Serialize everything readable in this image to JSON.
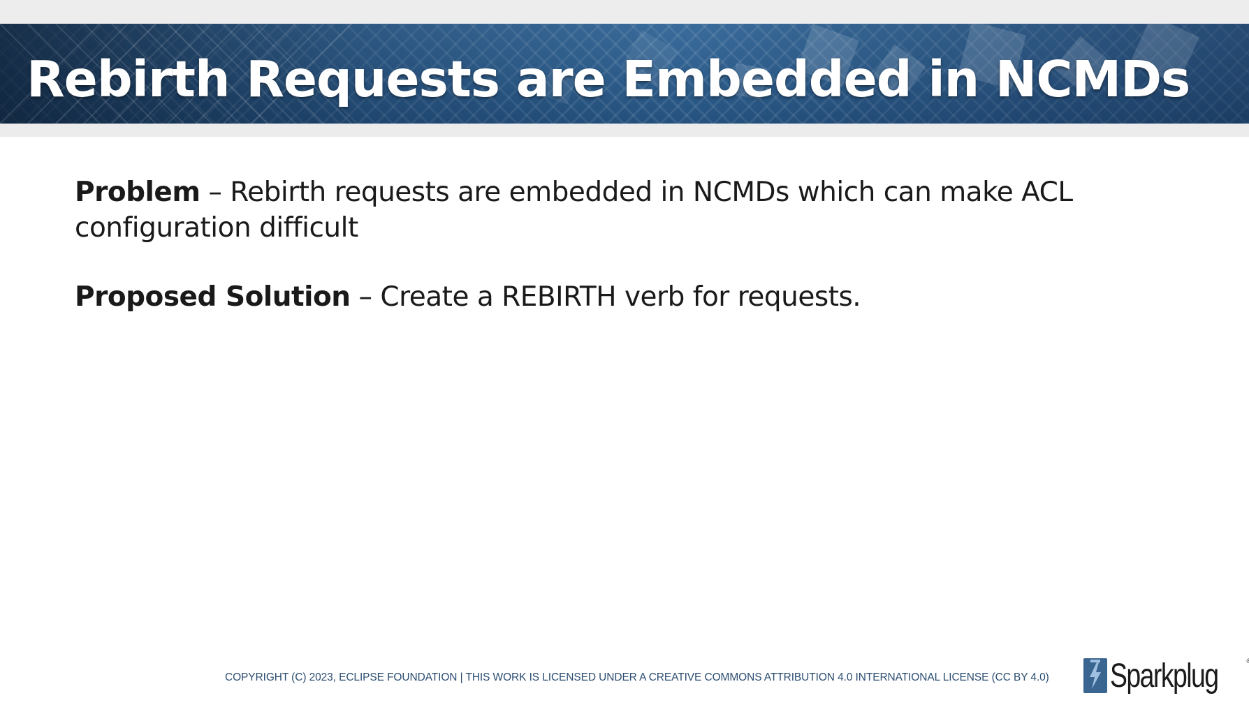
{
  "slide": {
    "title": "Rebirth Requests are Embedded in NCMDs",
    "paragraphs": [
      {
        "label": "Problem",
        "text": " – Rebirth requests are embedded in NCMDs which can make ACL configuration difficult"
      },
      {
        "label": "Proposed Solution",
        "text": " – Create a REBIRTH verb for requests."
      }
    ]
  },
  "footer": {
    "copyright": "COPYRIGHT (C) 2023, ECLIPSE FOUNDATION | THIS WORK IS LICENSED UNDER A CREATIVE COMMONS ATTRIBUTION 4.0 INTERNATIONAL LICENSE (CC BY 4.0)",
    "logo_text": "Sparkplug",
    "logo_mark": "®"
  },
  "colors": {
    "banner": "#2f5e8c",
    "title_text": "#ffffff",
    "body_text": "#1a1a1a",
    "footer_text": "#2b4d72",
    "logo_accent": "#3a6591"
  },
  "icons": {
    "logo": "sparkplug-logo-icon"
  }
}
